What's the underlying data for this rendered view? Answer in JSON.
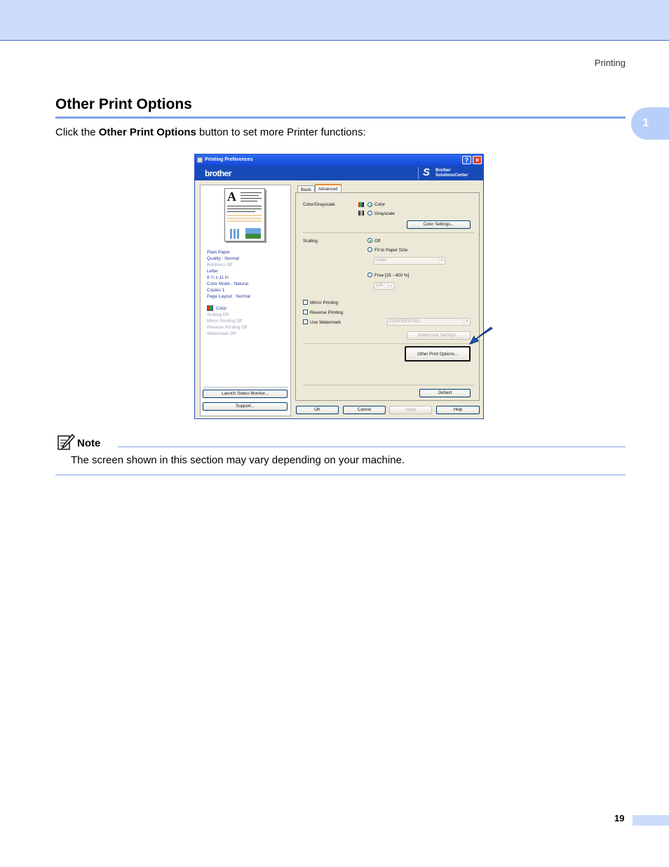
{
  "header": {
    "running_head": "Printing",
    "chapter": "1"
  },
  "section": {
    "title": "Other Print Options",
    "intro_prefix": "Click the ",
    "intro_bold": "Other Print Options",
    "intro_suffix": " button to set more Printer functions:"
  },
  "dialog": {
    "title": "Printing Preferences",
    "brand": "brother",
    "solutions_line1": "Brother",
    "solutions_line2": "SolutionsCenter",
    "summary": {
      "paper": "Plain Paper",
      "quality": "Quality : Normal",
      "boldness": "Boldness Off",
      "size": "Letter",
      "dimensions": "8 ½ x 11 in",
      "color_mode": "Color Mode : Natural",
      "copies": "Copies 1",
      "page_layout": "Page Layout : Normal",
      "color": "Color",
      "scaling": "Scaling Off",
      "mirror": "Mirror Printing Off",
      "reverse": "Reverse Printing Off",
      "watermark": "Watermark Off"
    },
    "buttons": {
      "launch_status_monitor": "Launch Status Monitor...",
      "support": "Support...",
      "ok": "OK",
      "cancel": "Cancel",
      "apply": "Apply",
      "help": "Help",
      "default": "Default",
      "color_settings": "Color Settings...",
      "watermark_settings": "Watermark Settings...",
      "other_print_options": "Other Print Options..."
    },
    "tabs": {
      "basic": "Basic",
      "advanced": "Advanced"
    },
    "color_grayscale": {
      "label": "Color/Grayscale",
      "color": "Color",
      "grayscale": "Grayscale"
    },
    "scaling": {
      "label": "Scaling",
      "off": "Off",
      "fit": "Fit to Paper Size",
      "paper_value": "Letter",
      "free": "Free [25 - 400 %]",
      "free_value": "100"
    },
    "options": {
      "mirror": "Mirror Printing",
      "reverse": "Reverse Printing",
      "use_watermark": "Use Watermark",
      "watermark_value": "CONFIDENTIAL"
    }
  },
  "note": {
    "label": "Note",
    "text": "The screen shown in this section may vary depending on your machine."
  },
  "footer": {
    "page_number": "19"
  }
}
